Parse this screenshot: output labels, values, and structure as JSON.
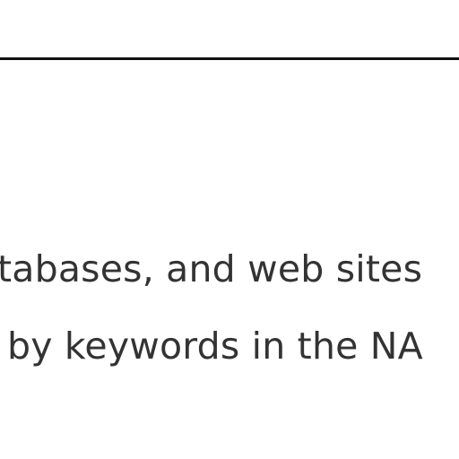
{
  "content": {
    "line1": "tabases, and web sites",
    "line2": "by keywords in the NA"
  },
  "colors": {
    "text": "#333333",
    "rule": "#111111",
    "background": "#ffffff"
  }
}
